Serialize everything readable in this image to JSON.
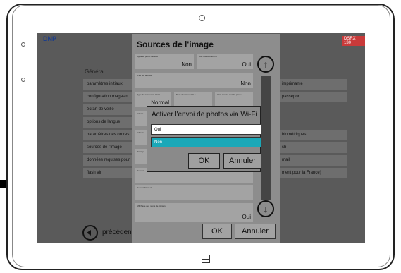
{
  "app": {
    "logo": "DNP",
    "badge": "DSRX 130"
  },
  "left_menu": {
    "section_title": "Général",
    "items": [
      {
        "label": "paramètres initiaux"
      },
      {
        "label": "configuration magasin"
      },
      {
        "label": "écran de veille"
      },
      {
        "label": "options de langue"
      },
      {
        "label": "paramètres des ordres"
      },
      {
        "label": "sources de l'image"
      },
      {
        "label": "données requises pour"
      },
      {
        "label": "flash air"
      }
    ],
    "back_label": "précédent"
  },
  "right_menu": {
    "items": [
      {
        "label": "imprimante"
      },
      {
        "label": "passeport"
      },
      {
        "label": "biométriques"
      },
      {
        "label": "sb"
      },
      {
        "label": "mail"
      },
      {
        "label": "ment pour la France)"
      }
    ]
  },
  "panel": {
    "title": "Sources de l'image",
    "fields": [
      {
        "label": "Appareil photo tablette",
        "value": "Non"
      },
      {
        "label": "Usb Wired Camera",
        "value": "Oui"
      },
      {
        "label": "USB sur accueil",
        "value": "Non"
      },
      {
        "label": "Type de connexion Wi-Fi",
        "value": "Normal"
      },
      {
        "label": "Nom du réseau Wi-fi",
        "value": ""
      },
      {
        "label": "Wi-fi réseau mot de passe",
        "value": ""
      },
      {
        "label": "Activer...",
        "value": ""
      },
      {
        "label": "Adresse...",
        "value": ""
      },
      {
        "label": "Partage...",
        "value": ""
      },
      {
        "label": "Dossier...",
        "value": ""
      },
      {
        "label": "Dossier favori 2",
        "value": ""
      },
      {
        "label": "Affichage des noms de fichiers",
        "value": "Oui"
      }
    ],
    "ok_label": "OK",
    "cancel_label": "Annuler"
  },
  "dialog": {
    "title": "Activer l'envoi de photos via Wi-Fi",
    "options": [
      {
        "label": "Oui",
        "selected": false
      },
      {
        "label": "Non",
        "selected": true
      }
    ],
    "ok_label": "OK",
    "cancel_label": "Annuler",
    "accent_color": "#1aa8b8"
  },
  "icons": {
    "up": "arrow-up-icon",
    "down": "arrow-down-icon",
    "back": "arrow-left-icon"
  }
}
